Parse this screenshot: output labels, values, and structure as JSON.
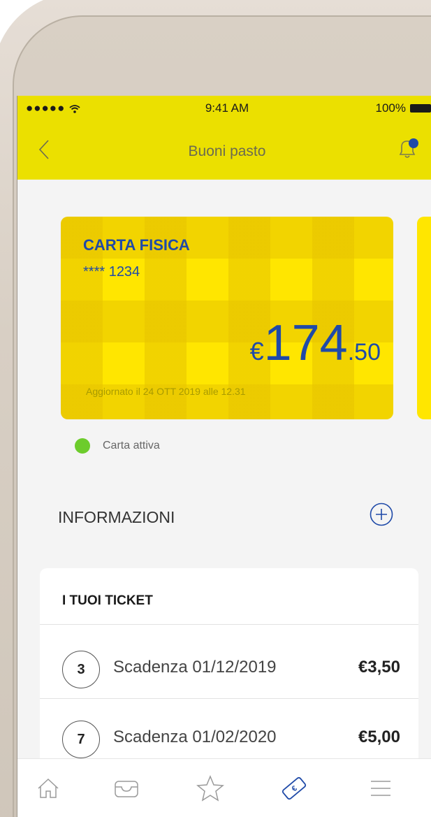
{
  "status_bar": {
    "signal": "●●●●● ",
    "time": "9:41 AM",
    "battery": "100%"
  },
  "header": {
    "title": "Buoni pasto"
  },
  "card": {
    "title": "CARTA FISICA",
    "number": "**** 1234",
    "currency": "€",
    "amount_int": "174",
    "amount_dec": ".50",
    "updated": "Aggiornato il 24 OTT 2019 alle 12.31"
  },
  "card_status": {
    "label": "Carta attiva",
    "color": "#6dcc2c"
  },
  "info": {
    "title": "INFORMAZIONI"
  },
  "tickets": {
    "title": "I TUOI TICKET",
    "rows": [
      {
        "count": "3",
        "label": "Scadenza 01/12/2019",
        "price": "€3,50"
      },
      {
        "count": "7",
        "label": "Scadenza 01/02/2020",
        "price": "€5,00"
      }
    ]
  },
  "tabbar": {
    "items": [
      "home-icon",
      "inbox-icon",
      "star-icon",
      "ticket-icon",
      "menu-icon"
    ],
    "active": "ticket-icon"
  },
  "colors": {
    "header": "#ebe000",
    "card": "#ffe600",
    "accent": "#1f4aa8",
    "status_active": "#6dcc2c"
  }
}
